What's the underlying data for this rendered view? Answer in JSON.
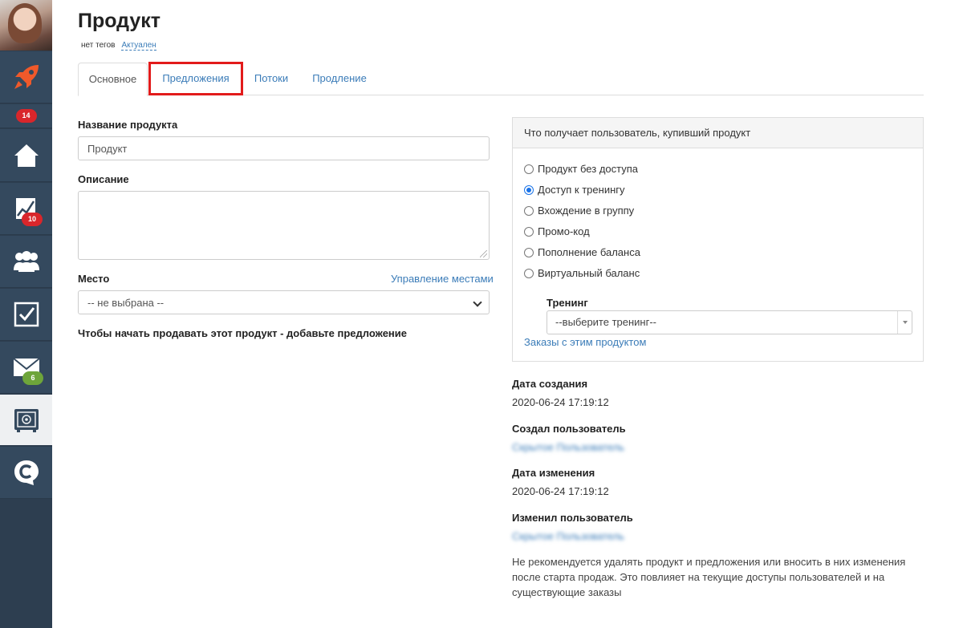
{
  "page": {
    "title": "Продукт",
    "tags_text": "нет тегов",
    "status": "Актуален"
  },
  "sidebar": {
    "items": [
      {
        "name": "rocket",
        "badge": "14"
      },
      {
        "name": "home",
        "badge": ""
      },
      {
        "name": "chart",
        "badge": "10"
      },
      {
        "name": "users",
        "badge": ""
      },
      {
        "name": "tasks",
        "badge": ""
      },
      {
        "name": "mail",
        "badge": "6"
      },
      {
        "name": "safe",
        "badge": ""
      },
      {
        "name": "chat",
        "badge": ""
      }
    ]
  },
  "tabs": [
    {
      "label": "Основное",
      "active": true
    },
    {
      "label": "Предложения",
      "active": false
    },
    {
      "label": "Потоки",
      "active": false
    },
    {
      "label": "Продление",
      "active": false
    }
  ],
  "form": {
    "name_label": "Название продукта",
    "name_value": "Продукт",
    "description_label": "Описание",
    "description_value": "",
    "place_label": "Место",
    "place_manage_link": "Управление местами",
    "place_value": "-- не выбрана --",
    "hint": "Чтобы начать продавать этот продукт - добавьте предложение"
  },
  "panel": {
    "header": "Что получает пользователь, купивший продукт",
    "options": [
      {
        "label": "Продукт без доступа",
        "checked": false
      },
      {
        "label": "Доступ к тренингу",
        "checked": true
      },
      {
        "label": "Вхождение в группу",
        "checked": false
      },
      {
        "label": "Промо-код",
        "checked": false
      },
      {
        "label": "Пополнение баланса",
        "checked": false
      },
      {
        "label": "Виртуальный баланс",
        "checked": false
      }
    ],
    "training_label": "Тренинг",
    "training_value": "--выберите тренинг--",
    "orders_link": "Заказы с этим продуктом"
  },
  "meta": {
    "created_label": "Дата создания",
    "created_value": "2020-06-24 17:19:12",
    "creator_label": "Создал пользователь",
    "creator_value": "Скрытое Пользователь",
    "modified_label": "Дата изменения",
    "modified_value": "2020-06-24 17:19:12",
    "modifier_label": "Изменил пользователь",
    "modifier_value": "Скрытое Пользователь"
  },
  "note": "Не рекомендуется удалять продукт и предложения или вносить в них изменения после старта продаж. Это повлияет на текущие доступы пользователей и на существующие заказы",
  "colors": {
    "sidebar_bg": "#34495e",
    "link": "#3b7cb8",
    "badge_red": "#d9262b",
    "badge_green": "#6ea53a",
    "rocket": "#f0592a",
    "highlight": "#e21b1b"
  }
}
